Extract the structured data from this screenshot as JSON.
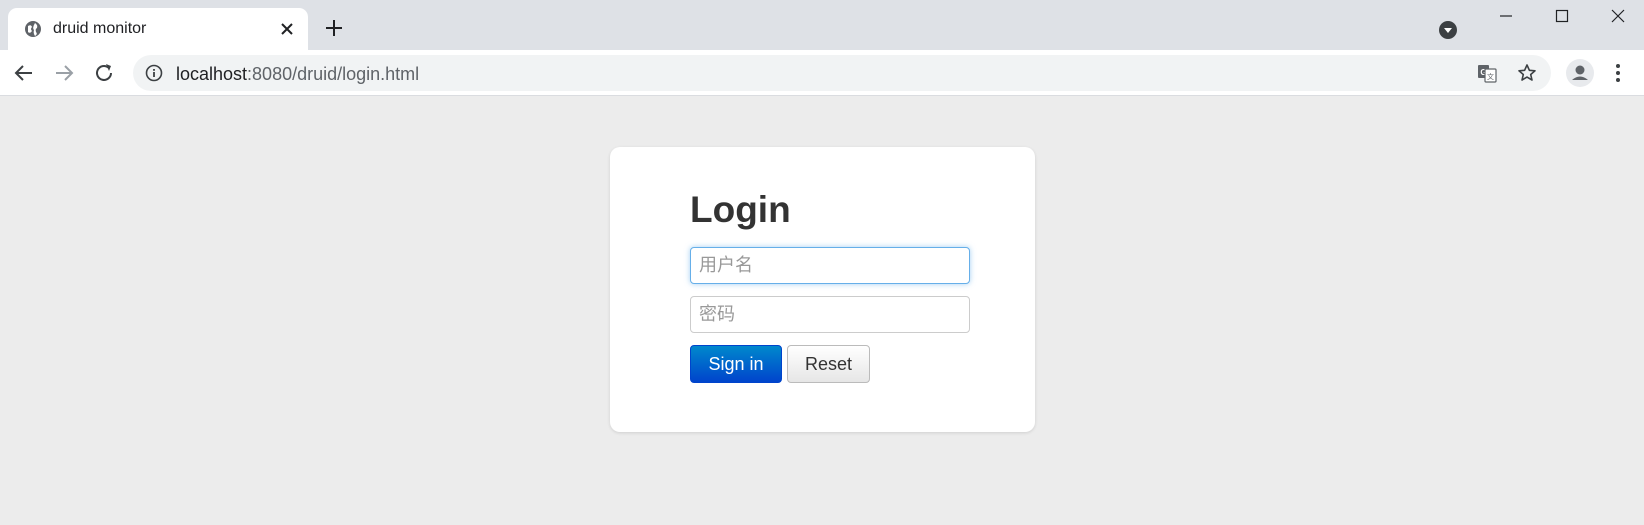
{
  "browser": {
    "tab": {
      "title": "druid monitor"
    },
    "address_bar": {
      "host": "localhost",
      "rest": ":8080/druid/login.html"
    }
  },
  "page": {
    "background": "#ececec",
    "login": {
      "title": "Login",
      "username_placeholder": "用户名",
      "username_value": "",
      "password_placeholder": "密码",
      "password_value": "",
      "sign_in_label": "Sign in",
      "reset_label": "Reset"
    }
  },
  "icons": [
    "globe-icon",
    "close-icon",
    "plus-icon",
    "tab-search-icon",
    "minimize-icon",
    "maximize-icon",
    "window-close-icon",
    "back-arrow-icon",
    "forward-arrow-icon",
    "reload-icon",
    "info-icon",
    "translate-icon",
    "star-icon",
    "profile-icon",
    "kebab-menu-icon"
  ],
  "colors": {
    "accent": "#0044cc",
    "focus": "#66afe9"
  }
}
